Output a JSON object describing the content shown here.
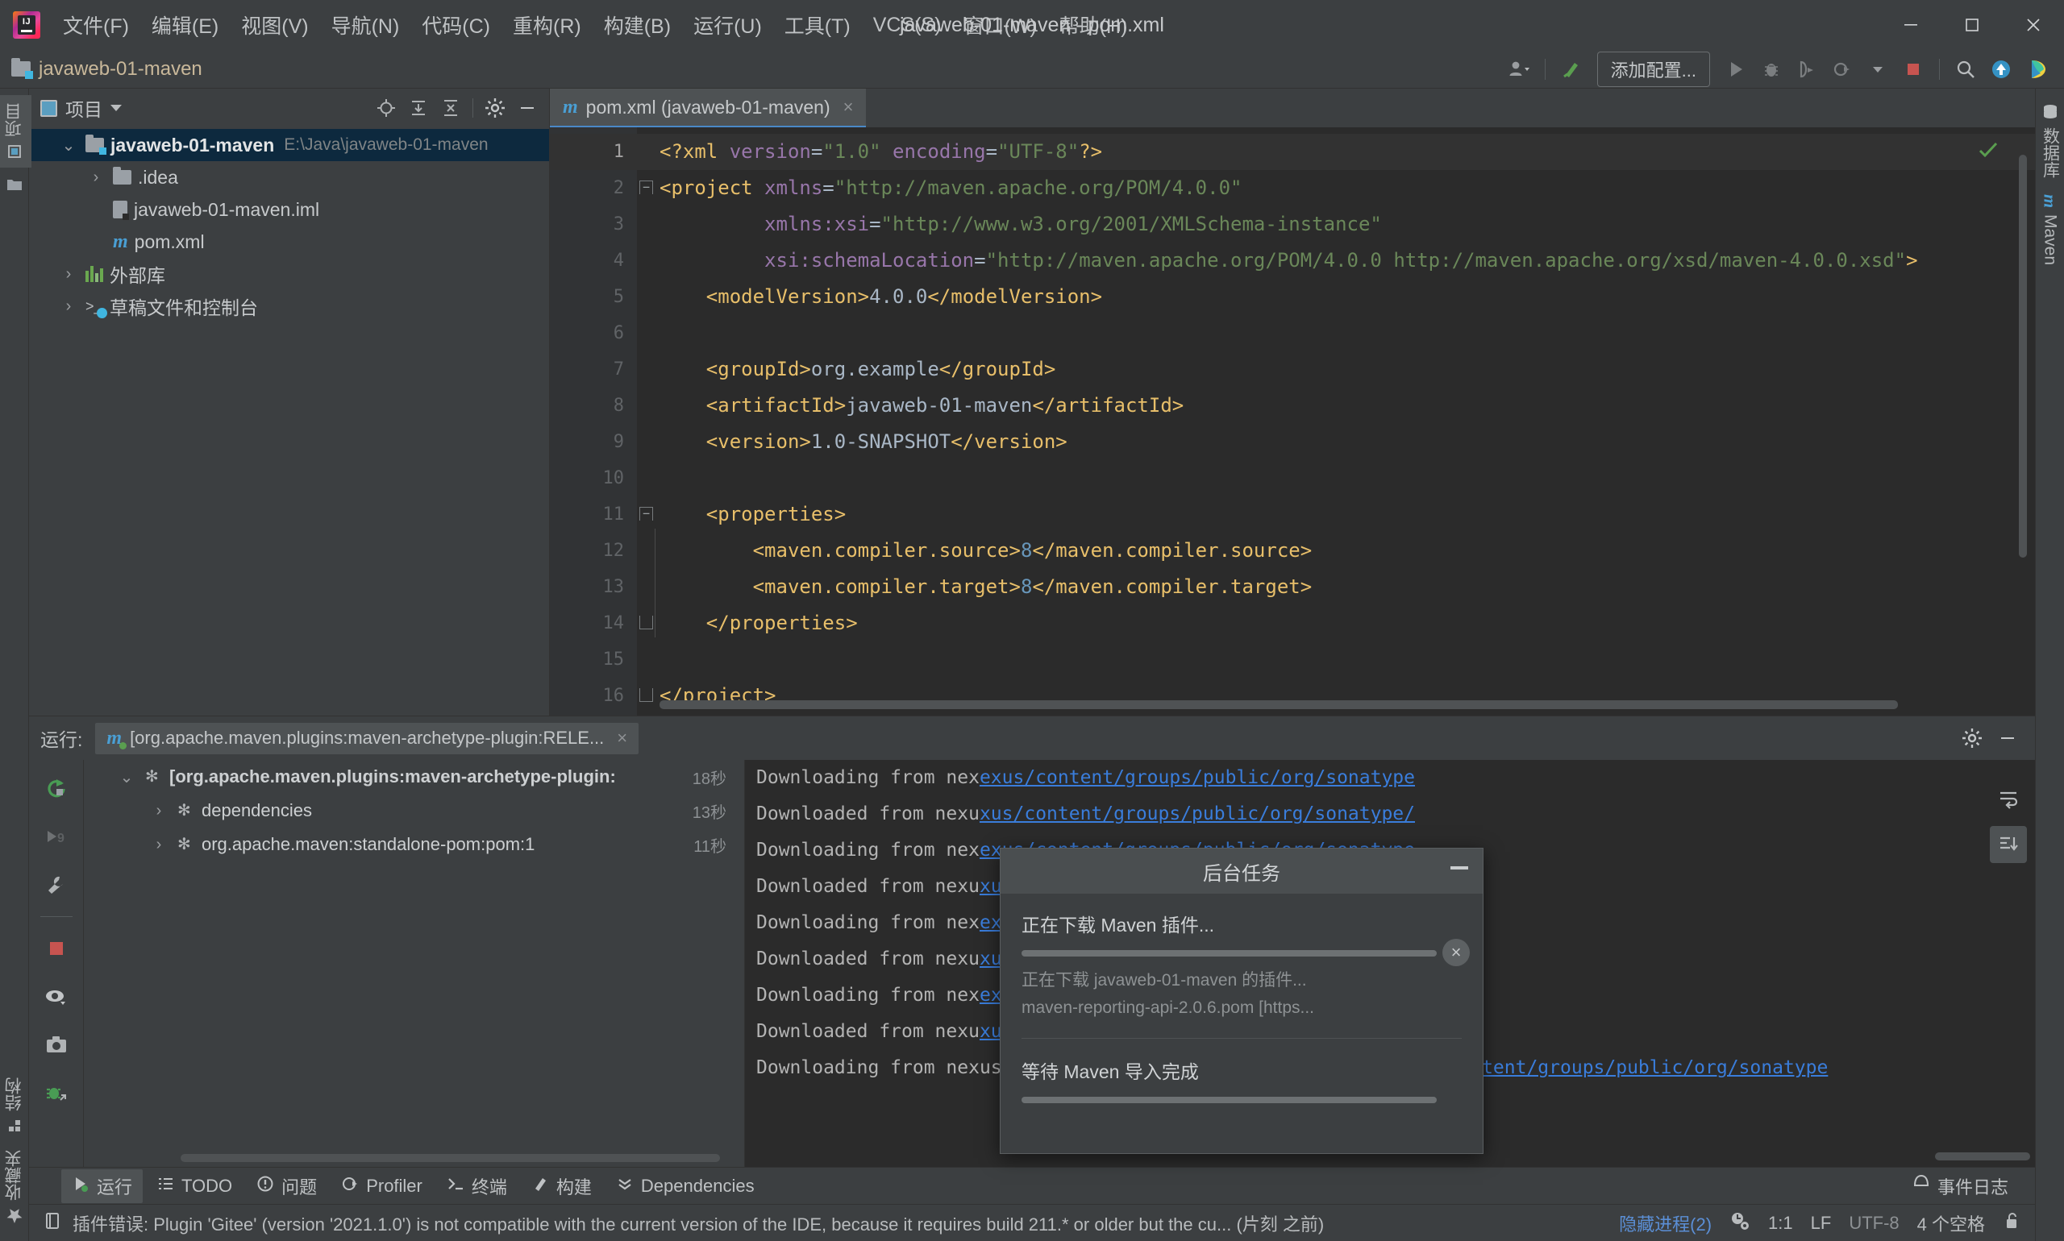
{
  "window": {
    "title": "javaweb-01-maven - pom.xml",
    "minimize_label": "最小化",
    "maximize_label": "最大化",
    "close_label": "关闭"
  },
  "menu": [
    {
      "label": "文件(F)"
    },
    {
      "label": "编辑(E)"
    },
    {
      "label": "视图(V)"
    },
    {
      "label": "导航(N)"
    },
    {
      "label": "代码(C)"
    },
    {
      "label": "重构(R)"
    },
    {
      "label": "构建(B)"
    },
    {
      "label": "运行(U)"
    },
    {
      "label": "工具(T)"
    },
    {
      "label": "VCS(S)"
    },
    {
      "label": "窗口(W)"
    },
    {
      "label": "帮助(H)"
    }
  ],
  "toolbar": {
    "project_name": "javaweb-01-maven",
    "add_config_label": "添加配置...",
    "user_icon": "user-icon",
    "build_icon": "hammer-icon",
    "run_icon": "run-icon",
    "debug_icon": "debug-icon",
    "coverage_icon": "coverage-icon",
    "profile_icon": "profile-icon",
    "stop_icon": "stop-icon",
    "search_icon": "search-icon",
    "update_icon": "update-project-icon",
    "ide_icon": "ide-icon"
  },
  "left_strip": [
    {
      "label": "项目",
      "selected": true,
      "icon": "project-icon"
    },
    {
      "label": "",
      "selected": false,
      "icon": "folder-icon"
    },
    {
      "label": "结构",
      "selected": false,
      "icon": "structure-icon"
    },
    {
      "label": "收藏夹",
      "selected": false,
      "icon": "star-icon"
    }
  ],
  "right_strip": [
    {
      "label": "数据库",
      "icon": "database-icon"
    },
    {
      "label": "Maven",
      "icon": "maven-icon"
    }
  ],
  "project_panel": {
    "title": "项目",
    "actions": [
      "locate-icon",
      "expand-all-icon",
      "collapse-all-icon",
      "gear-icon",
      "minimize-icon"
    ],
    "tree": [
      {
        "label": "javaweb-01-maven",
        "path": "E:\\Java\\javaweb-01-maven",
        "icon": "project-folder-icon",
        "depth": 0,
        "expanded": true,
        "selected": true,
        "bold": true
      },
      {
        "label": ".idea",
        "path": "",
        "icon": "folder-icon",
        "depth": 1,
        "expanded": false,
        "selected": false,
        "bold": false
      },
      {
        "label": "javaweb-01-maven.iml",
        "path": "",
        "icon": "iml-file-icon",
        "depth": 1,
        "expanded": null,
        "selected": false,
        "bold": false
      },
      {
        "label": "pom.xml",
        "path": "",
        "icon": "maven-file-icon",
        "depth": 1,
        "expanded": null,
        "selected": false,
        "bold": false
      },
      {
        "label": "外部库",
        "path": "",
        "icon": "library-icon",
        "depth": 0,
        "expanded": false,
        "selected": false,
        "bold": false
      },
      {
        "label": "草稿文件和控制台",
        "path": "",
        "icon": "scratch-console-icon",
        "depth": 0,
        "expanded": false,
        "selected": false,
        "bold": false
      }
    ]
  },
  "editor": {
    "tab": {
      "label": "pom.xml (javaweb-01-maven)",
      "icon": "maven-file-icon",
      "close": "×"
    },
    "inspection_status": "ok-check-icon",
    "lines": [
      {
        "n": 1,
        "current": true,
        "fold": null,
        "html": "<span class='tg'>&lt;?xml</span> <span class='at'>version</span>=<span class='st'>\"1.0\"</span> <span class='at'>encoding</span>=<span class='st'>\"UTF-8\"</span><span class='tg'>?&gt;</span>"
      },
      {
        "n": 2,
        "current": false,
        "fold": "top",
        "html": "<span class='tg'>&lt;project</span> <span class='at'>xmlns</span>=<span class='st'>\"http://maven.apache.org/POM/4.0.0\"</span>"
      },
      {
        "n": 3,
        "current": false,
        "fold": null,
        "html": "         <span class='at'>xmlns:xsi</span>=<span class='st'>\"http://www.w3.org/2001/XMLSchema-instance\"</span>"
      },
      {
        "n": 4,
        "current": false,
        "fold": null,
        "html": "         <span class='at'>xsi:schemaLocation</span>=<span class='st'>\"http://maven.apache.org/POM/4.0.0 http://maven.apache.org/xsd/maven-4.0.0.xsd\"</span><span class='tg'>&gt;</span>"
      },
      {
        "n": 5,
        "current": false,
        "fold": null,
        "html": "    <span class='tg'>&lt;modelVersion&gt;</span>4.0.0<span class='tg'>&lt;/modelVersion&gt;</span>"
      },
      {
        "n": 6,
        "current": false,
        "fold": null,
        "html": ""
      },
      {
        "n": 7,
        "current": false,
        "fold": null,
        "html": "    <span class='tg'>&lt;groupId&gt;</span>org.example<span class='tg'>&lt;/groupId&gt;</span>"
      },
      {
        "n": 8,
        "current": false,
        "fold": null,
        "html": "    <span class='tg'>&lt;artifactId&gt;</span>javaweb-01-maven<span class='tg'>&lt;/artifactId&gt;</span>"
      },
      {
        "n": 9,
        "current": false,
        "fold": null,
        "html": "    <span class='tg'>&lt;version&gt;</span>1.0-SNAPSHOT<span class='tg'>&lt;/version&gt;</span>"
      },
      {
        "n": 10,
        "current": false,
        "fold": null,
        "html": ""
      },
      {
        "n": 11,
        "current": false,
        "fold": "top",
        "html": "    <span class='tg'>&lt;properties&gt;</span>"
      },
      {
        "n": 12,
        "current": false,
        "fold": null,
        "html": "        <span class='tg'>&lt;maven.compiler.source&gt;</span><span class='nm'>8</span><span class='tg'>&lt;/maven.compiler.source&gt;</span>"
      },
      {
        "n": 13,
        "current": false,
        "fold": null,
        "html": "        <span class='tg'>&lt;maven.compiler.target&gt;</span><span class='nm'>8</span><span class='tg'>&lt;/maven.compiler.target&gt;</span>"
      },
      {
        "n": 14,
        "current": false,
        "fold": "bot",
        "html": "    <span class='tg'>&lt;/properties&gt;</span>"
      },
      {
        "n": 15,
        "current": false,
        "fold": null,
        "html": ""
      },
      {
        "n": 16,
        "current": false,
        "fold": "bot",
        "html": "<span class='tg'>&lt;/project&gt;</span>"
      }
    ]
  },
  "run_panel": {
    "label": "运行:",
    "tab_label": "[org.apache.maven.plugins:maven-archetype-plugin:RELE...",
    "tab_icon": "maven-run-icon",
    "tab_close": "×",
    "settings_icon": "gear-icon",
    "minimize_icon": "minimize-icon",
    "side_buttons": [
      "rerun-icon",
      "skip-tests-icon",
      "wrench-icon",
      "stop-icon",
      "eye-icon",
      "camera-icon",
      "thread-dump-icon"
    ],
    "tasks": [
      {
        "label": "[org.apache.maven.plugins:maven-archetype-plugin:",
        "duration": "18秒",
        "depth": 0,
        "expanded": true,
        "bold": true
      },
      {
        "label": "dependencies",
        "duration": "13秒",
        "depth": 1,
        "expanded": false,
        "bold": false
      },
      {
        "label": "org.apache.maven:standalone-pom:pom:1",
        "duration": "11秒",
        "depth": 1,
        "expanded": false,
        "bold": false
      }
    ],
    "console": [
      {
        "prefix": "Downloading from nexus-aliyun: ",
        "url": "https://maven.aliyun.com/nexus/content/groups/public/org/sonatype"
      },
      {
        "prefix": "Downloaded from nexu",
        "url": "xus/content/groups/public/org/sonatype/"
      },
      {
        "prefix": "Downloading from nex",
        "url": "exus/content/groups/public/org/codehaus"
      },
      {
        "prefix": "Downloaded from nexu",
        "url": "xus/content/groups/public/org/codehaus/"
      },
      {
        "prefix": "Downloading from nex",
        "url": "exus/content/groups/public/org/codehaus"
      },
      {
        "prefix": "Downloaded from nexu",
        "url": "xus/content/groups/public/org/codehaus/"
      },
      {
        "prefix": "Downloading from nex",
        "url": "exus/content/groups/public/org/sonatype"
      },
      {
        "prefix": "Downloaded from nexu",
        "url": "xus/content/groups/public/org/sonatype/"
      },
      {
        "prefix": "Downloading from nex",
        "url": "exus/content/groups/public/org/sonatype"
      }
    ],
    "console_buttons": [
      "soft-wrap-icon",
      "scroll-to-end-icon"
    ]
  },
  "background_tasks": {
    "title": "后台任务",
    "minimize_icon": "minimize-icon",
    "cancel_icon": "cancel-icon",
    "tasks": [
      {
        "title": "正在下载 Maven 插件...",
        "progress": 100,
        "sub_line1": "正在下载 javaweb-01-maven 的插件...",
        "sub_line2": "maven-reporting-api-2.0.6.pom [https...",
        "cancellable": true
      },
      {
        "title": "等待 Maven 导入完成",
        "progress": 100,
        "sub_line1": "",
        "sub_line2": "",
        "cancellable": false
      }
    ]
  },
  "bottom_toolstrip": [
    {
      "label": "运行",
      "icon": "run-icon",
      "selected": true
    },
    {
      "label": "TODO",
      "icon": "todo-icon",
      "selected": false
    },
    {
      "label": "问题",
      "icon": "problems-icon",
      "selected": false
    },
    {
      "label": "Profiler",
      "icon": "profiler-icon",
      "selected": false
    },
    {
      "label": "终端",
      "icon": "terminal-icon",
      "selected": false
    },
    {
      "label": "构建",
      "icon": "build-icon",
      "selected": false
    },
    {
      "label": "Dependencies",
      "icon": "dependencies-icon",
      "selected": false
    }
  ],
  "bottom_toolstrip_right": [
    {
      "label": "事件日志",
      "icon": "event-log-icon"
    }
  ],
  "statusbar": {
    "icon": "plugin-icon",
    "message": "插件错误: Plugin 'Gitee' (version '2021.1.0') is not compatible with the current version of the IDE, because it requires build 211.* or older but the cu... (片刻 之前)",
    "hide_processes": "隐藏进程(2)",
    "process_icon": "background-process-icon",
    "caret_position": "1:1",
    "line_separator": "LF",
    "encoding": "UTF-8",
    "indent": "4 个空格",
    "lock_icon": "unlock-icon"
  },
  "colors": {
    "bg_panel": "#3c3f41",
    "bg_editor": "#2b2b2b",
    "selection_blue": "#0d293e",
    "accent_blue": "#4a88c7",
    "link_blue": "#3a7ddb",
    "tag_orange": "#e8bf6a",
    "string_green": "#6a8759",
    "attr_purple": "#9876aa",
    "number_blue": "#6897bb",
    "stop_red": "#c75450",
    "green": "#499c54"
  }
}
